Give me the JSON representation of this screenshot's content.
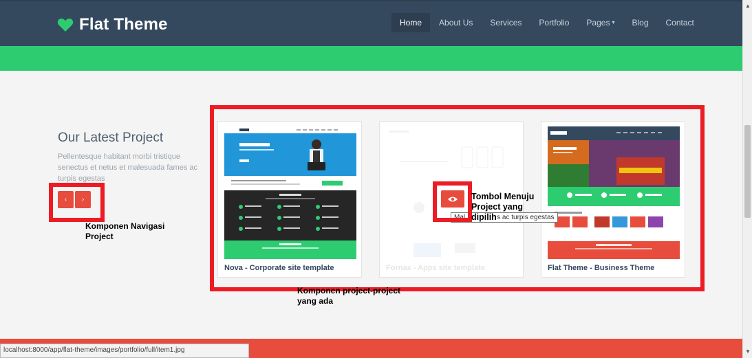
{
  "header": {
    "brand": "Flat Theme",
    "nav": [
      "Home",
      "About Us",
      "Services",
      "Portfolio",
      "Pages",
      "Blog",
      "Contact"
    ],
    "active": "Home"
  },
  "intro": {
    "title": "Our Latest Project",
    "description": "Pellentesque habitant morbi tristique senectus et netus et malesuada fames ac turpis egestas"
  },
  "projects": [
    {
      "caption": "Nova - Corporate site template"
    },
    {
      "caption": "Fornax - Apps site template"
    },
    {
      "caption": "Flat Theme - Business Theme"
    }
  ],
  "annotations": {
    "navigation": "Komponen Navigasi Project",
    "button": "Tombol Menuju Project yang dipilih",
    "projects": "Komponen project-project yang ada"
  },
  "tooltip": "Malesuada fames ac turpis egestas",
  "tooltip_visible_prefix": "Mal",
  "tooltip_visible_suffix": "s ac turpis egestas",
  "status_url": "localhost:8000/app/flat-theme/images/portfolio/full/item1.jpg",
  "colors": {
    "header": "#34495e",
    "green": "#2ecc71",
    "red": "#e74c3c",
    "annotation": "#ed1c24"
  }
}
